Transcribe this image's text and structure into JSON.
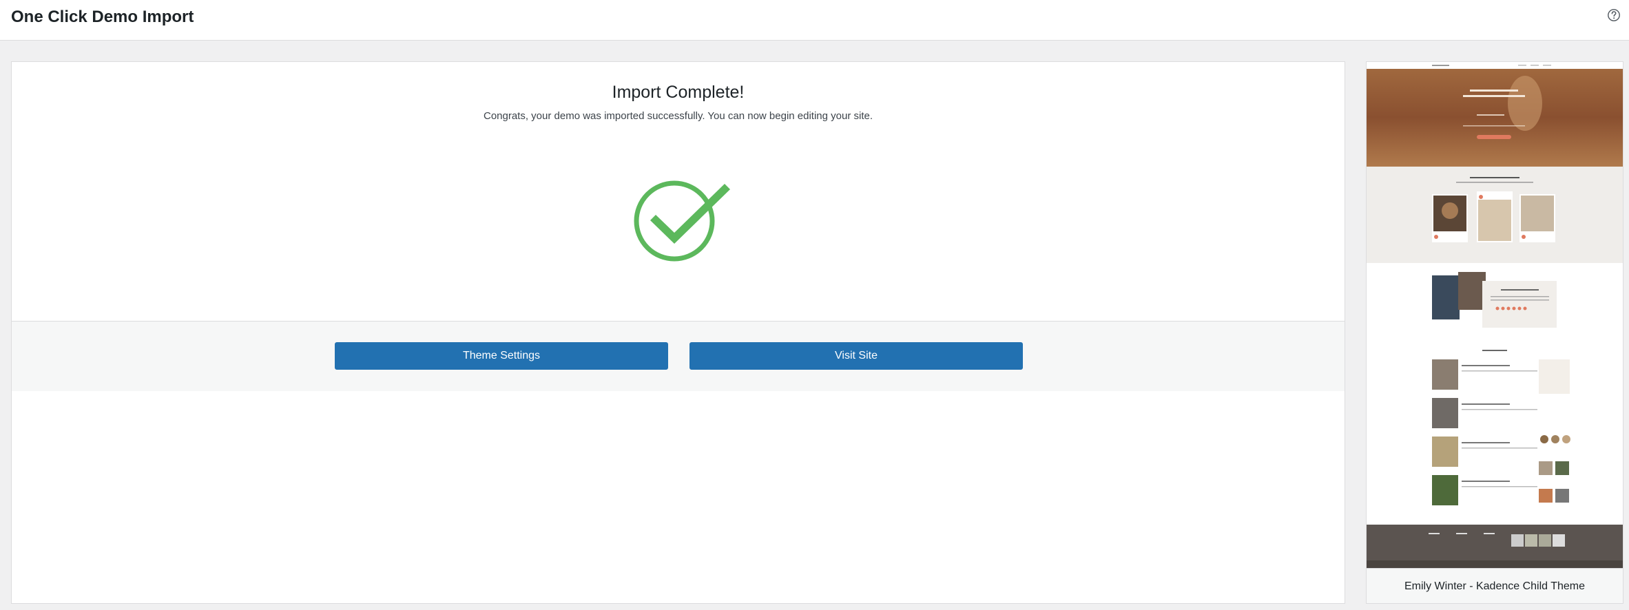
{
  "header": {
    "title": "One Click Demo Import",
    "help_icon": "question-circle-icon"
  },
  "main": {
    "heading": "Import Complete!",
    "message": "Congrats, your demo was imported successfully. You can now begin editing your site.",
    "success_icon": "checkmark-circle-icon",
    "success_color": "#5cb85c",
    "buttons": {
      "theme_settings": "Theme Settings",
      "visit_site": "Visit Site"
    },
    "button_color": "#2271b1"
  },
  "preview": {
    "caption": "Emily Winter - Kadence Child Theme",
    "image": "demo-site-preview-thumbnail"
  }
}
